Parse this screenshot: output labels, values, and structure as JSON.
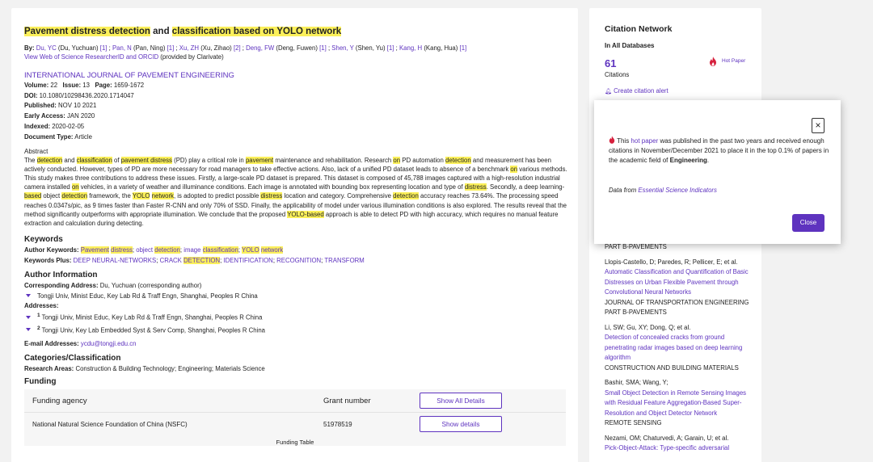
{
  "record": {
    "title": {
      "parts": [
        {
          "t": "Pavement distress detection",
          "hl": true
        },
        {
          "t": " and ",
          "hl": false
        },
        {
          "t": "classification based on YOLO network",
          "hl": true
        }
      ]
    },
    "by_label": "By:",
    "authors": [
      {
        "link": "Du, YC",
        "full": " (Du, Yuchuan) ",
        "ref": "[1]",
        "sep": " ; "
      },
      {
        "link": "Pan, N",
        "full": " (Pan, Ning) ",
        "ref": "[1]",
        "sep": " ; "
      },
      {
        "link": "Xu, ZH",
        "full": " (Xu, Zihao) ",
        "ref": "[2]",
        "sep": " ; "
      },
      {
        "link": "Deng, FW",
        "full": " (Deng, Fuwen) ",
        "ref": "[1]",
        "sep": " ; "
      },
      {
        "link": "Shen, Y",
        "full": " (Shen, Yu) ",
        "ref": "[1]",
        "sep": " ; "
      },
      {
        "link": "Kang, H",
        "full": " (Kang, Hua) ",
        "ref": "[1]",
        "sep": ""
      }
    ],
    "researcher_link": "View Web of Science ResearcherID and ORCID",
    "researcher_suffix": " (provided by Clarivate)",
    "journal": "INTERNATIONAL JOURNAL OF PAVEMENT ENGINEERING",
    "volume_label": "Volume:",
    "volume": "22",
    "issue_label": "Issue:",
    "issue": "13",
    "page_label": "Page:",
    "pages": "1659-1672",
    "doi_label": "DOI:",
    "doi": "10.1080/10298436.2020.1714047",
    "published_label": "Published:",
    "published": "NOV 10 2021",
    "early_label": "Early Access:",
    "early_access": "JAN 2020",
    "indexed_label": "Indexed:",
    "indexed": "2020-02-05",
    "doctype_label": "Document Type:",
    "doctype": "Article",
    "abstract_heading": "Abstract",
    "abstract_parts": [
      {
        "t": "The "
      },
      {
        "t": "detection",
        "hl": true
      },
      {
        "t": " and "
      },
      {
        "t": "classification",
        "hl": true
      },
      {
        "t": " of "
      },
      {
        "t": "pavement distress",
        "hl": true
      },
      {
        "t": " (PD) play a critical role in "
      },
      {
        "t": "pavement",
        "hl": true
      },
      {
        "t": " maintenance and rehabilitation. Research "
      },
      {
        "t": "on",
        "hl": true
      },
      {
        "t": " PD automation "
      },
      {
        "t": "detection",
        "hl": true
      },
      {
        "t": " and measurement has been actively conducted. However, types of PD are more necessary for road managers to take effective actions. Also, lack of a unified PD dataset leads to absence of a benchmark "
      },
      {
        "t": "on",
        "hl": true
      },
      {
        "t": " various methods. This study makes three contributions to address these issues. Firstly, a large-scale PD dataset is prepared. This dataset is composed of 45,788 images captured with a high-resolution industrial camera installed "
      },
      {
        "t": "on",
        "hl": true
      },
      {
        "t": " vehicles, in a variety of weather and illuminance conditions. Each image is annotated with bounding box representing location and type of "
      },
      {
        "t": "distress",
        "hl": true
      },
      {
        "t": ". Secondly, a deep learning-"
      },
      {
        "t": "based",
        "hl": true
      },
      {
        "t": " object "
      },
      {
        "t": "detection",
        "hl": true
      },
      {
        "t": " framework, the "
      },
      {
        "t": "YOLO",
        "hl": true
      },
      {
        "t": " "
      },
      {
        "t": "network",
        "hl": true
      },
      {
        "t": ", is adopted to predict possible "
      },
      {
        "t": "distress",
        "hl": true
      },
      {
        "t": " location and category. Comprehensive "
      },
      {
        "t": "detection",
        "hl": true
      },
      {
        "t": " accuracy reaches 73.64%. The processing speed reaches 0.0347s/pic, as 9 times faster than Faster R-CNN and only 70% of SSD. Finally, the applicability of model under various illumination conditions is also explored. The results reveal that the method significantly outperforms with appropriate illumination. We conclude that the proposed "
      },
      {
        "t": "YOLO-based",
        "hl": true
      },
      {
        "t": " approach is able to detect PD with high accuracy, which requires no manual feature extraction and calculation during detecting."
      }
    ],
    "keywords_heading": "Keywords",
    "author_kw_label": "Author Keywords:",
    "author_kw_parts": [
      {
        "t": "Pavement",
        "hl": true,
        "link": true
      },
      {
        "t": " ",
        "hl": false,
        "link": true
      },
      {
        "t": "distress",
        "hl": true,
        "link": true
      },
      {
        "t": "; ",
        "hl": false,
        "link": false
      },
      {
        "t": "object ",
        "hl": false,
        "link": true
      },
      {
        "t": "detection",
        "hl": true,
        "link": true
      },
      {
        "t": "; ",
        "hl": false,
        "link": false
      },
      {
        "t": "image ",
        "hl": false,
        "link": true
      },
      {
        "t": "classification",
        "hl": true,
        "link": true
      },
      {
        "t": "; ",
        "hl": false,
        "link": false
      },
      {
        "t": "YOLO",
        "hl": true,
        "link": true
      },
      {
        "t": " ",
        "hl": false,
        "link": true
      },
      {
        "t": "network",
        "hl": true,
        "link": true
      }
    ],
    "plus_kw_label": "Keywords Plus:",
    "plus_kw_parts": [
      {
        "t": "DEEP NEURAL-NETWORKS",
        "hl": false,
        "link": true
      },
      {
        "t": "; ",
        "hl": false,
        "link": false
      },
      {
        "t": "CRACK ",
        "hl": false,
        "link": true
      },
      {
        "t": "DETECTION",
        "hl": true,
        "link": true
      },
      {
        "t": "; ",
        "hl": false,
        "link": false
      },
      {
        "t": "IDENTIFICATION",
        "hl": false,
        "link": true
      },
      {
        "t": "; ",
        "hl": false,
        "link": false
      },
      {
        "t": "RECOGNITION",
        "hl": false,
        "link": true
      },
      {
        "t": "; ",
        "hl": false,
        "link": false
      },
      {
        "t": "TRANSFORM",
        "hl": false,
        "link": true
      }
    ],
    "author_info_heading": "Author Information",
    "corr_label": "Corresponding Address:",
    "corr_name": "Du, Yuchuan",
    "corr_suffix": " (corresponding author)",
    "corr_address": "Tongji Univ, Minist Educ, Key Lab Rd & Traff Engn, Shanghai, Peoples R China",
    "addresses_label": "Addresses:",
    "addresses": [
      {
        "num": "1",
        "text": "Tongji Univ, Minist Educ, Key Lab Rd & Traff Engn, Shanghai, Peoples R China"
      },
      {
        "num": "2",
        "text": "Tongji Univ, Key Lab Embedded Syst & Serv Comp, Shanghai, Peoples R China"
      }
    ],
    "email_label": "E-mail Addresses:",
    "email": "ycdu@tongji.edu.cn",
    "categories_heading": "Categories/Classification",
    "research_areas_label": "Research Areas:",
    "research_areas": "Construction & Building Technology; Engineering; Materials Science",
    "funding_heading": "Funding",
    "funding_col1": "Funding agency",
    "funding_col2": "Grant number",
    "show_all_details": "Show All Details",
    "funding_agency": "National Natural Science Foundation of China (NSFC)",
    "grant_number": "51978519",
    "show_details": "Show details",
    "funding_caption": "Funding Table"
  },
  "citation": {
    "heading": "Citation Network",
    "db_label": "In All Databases",
    "count": "61",
    "count_label": "Citations",
    "hot_paper": "Hot Paper",
    "create_alert": "Create citation alert",
    "items": [
      {
        "authors": "Llopis-Castello, D; Paredes, R; Pellicer, E; et al.",
        "title": "Automatic Classification and Quantification of Basic Distresses on Urban Flexible Pavement through Convolutional Neural Networks",
        "source": "JOURNAL OF TRANSPORTATION ENGINEERING PART B-PAVEMENTS"
      },
      {
        "authors": "Li, SW; Gu, XY; Dong, Q; et al.",
        "title": "Detection of concealed cracks from ground penetrating radar images based on deep learning algorithm",
        "source": "CONSTRUCTION AND BUILDING MATERIALS"
      },
      {
        "authors": "Bashir, SMA; Wang, Y;",
        "title": "Small Object Detection in Remote Sensing Images with Residual Feature Aggregation-Based Super-Resolution and Object Detector Network",
        "source": "REMOTE SENSING"
      },
      {
        "authors": "Nezami, OM; Chaturvedi, A; Garain, U; et al.",
        "title": "Pick-Object-Attack: Type-specific adversarial",
        "source": ""
      }
    ],
    "partial_source": "PART B-PAVEMENTS"
  },
  "popup": {
    "text_pre": "This ",
    "text_link": "hot paper",
    "text_post": " was published in the past two years and received enough citations in November/December 2021 to place it in the top 0.1% of papers in the academic field of ",
    "text_field": "Engineering",
    "text_end": ".",
    "source_pre": "Data from ",
    "source_link": "Essential Science Indicators",
    "close_x": "×",
    "close_label": "Close"
  }
}
